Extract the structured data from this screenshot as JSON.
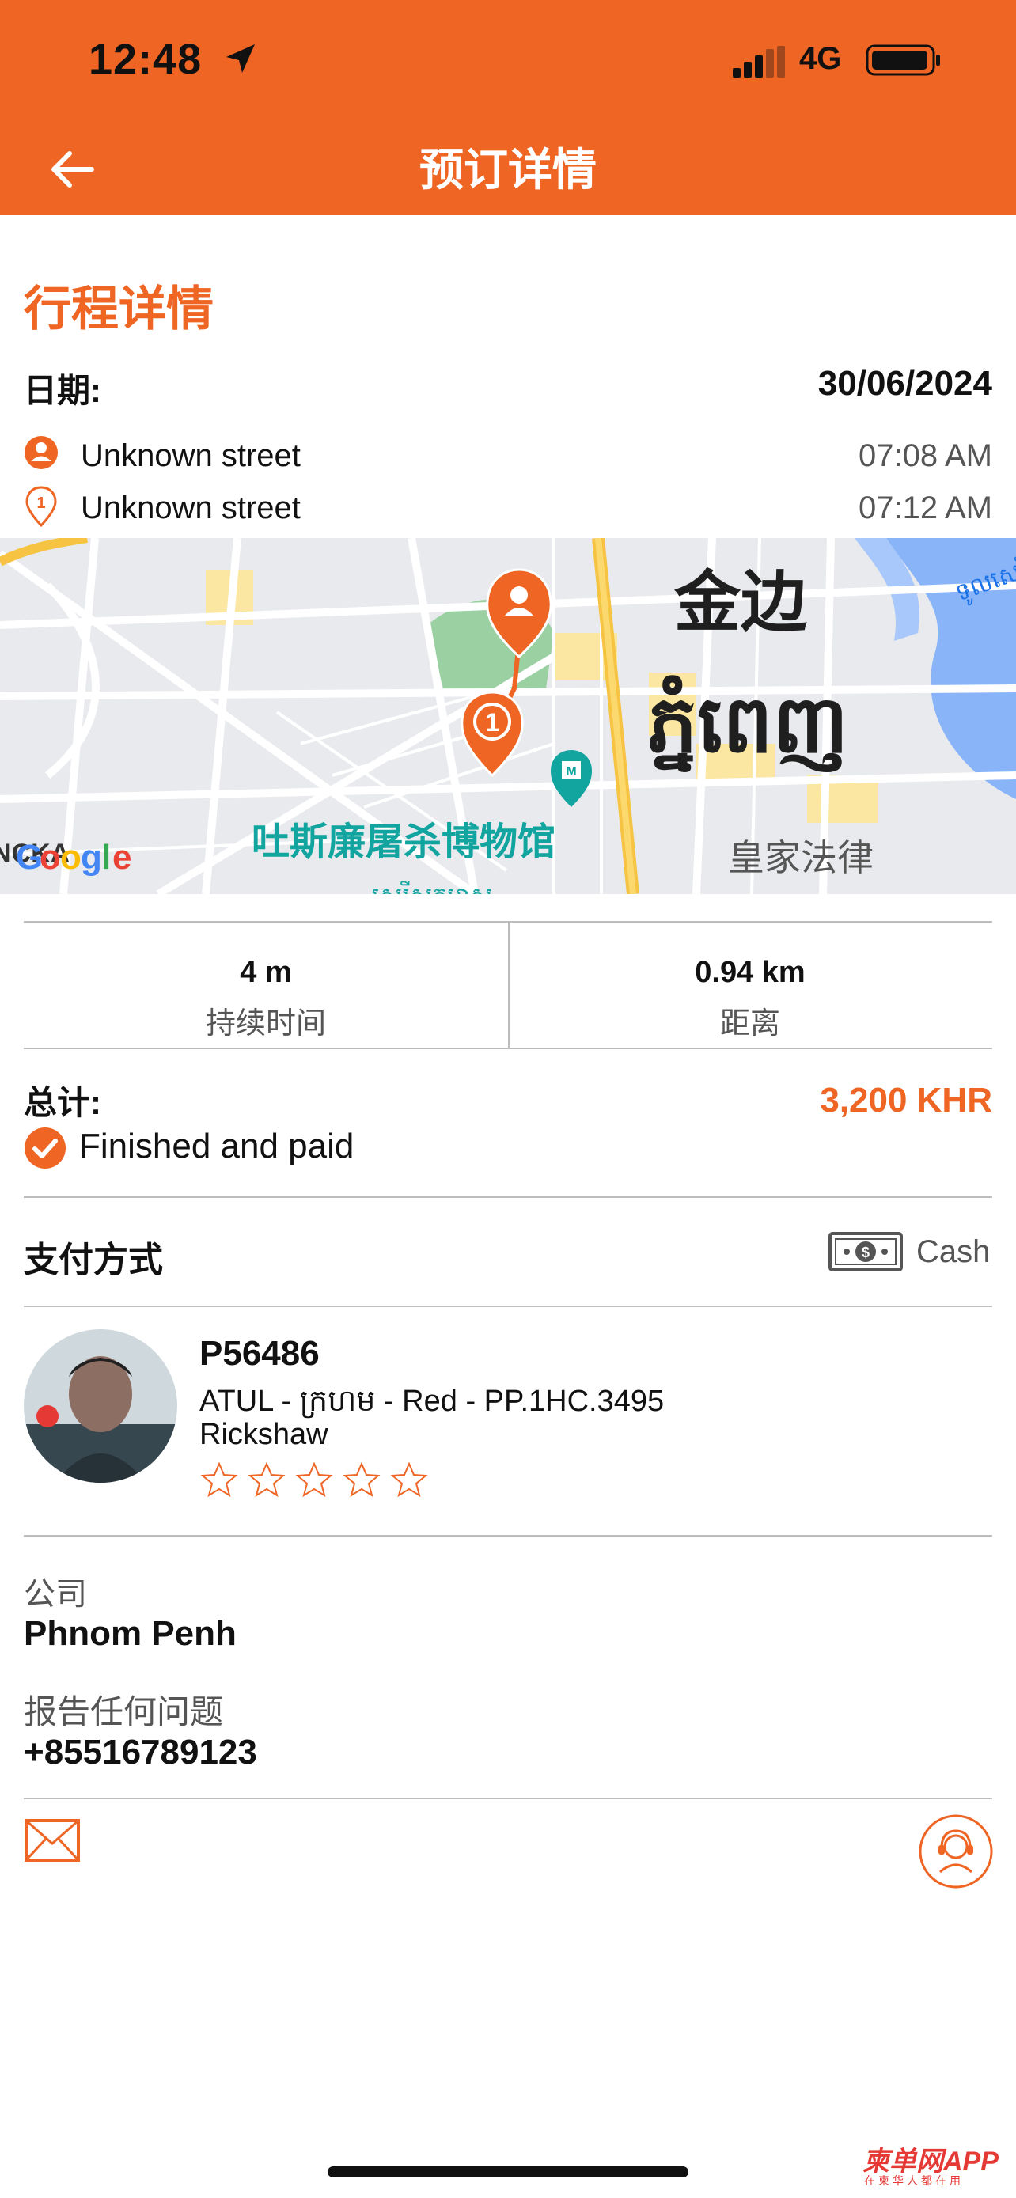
{
  "status_bar": {
    "time": "12:48",
    "network": "4G"
  },
  "header": {
    "title": "预订详情"
  },
  "trip": {
    "section_title": "行程详情",
    "date_label": "日期:",
    "date_value": "30/06/2024",
    "pickup": {
      "label": "Unknown street",
      "time": "07:08 AM"
    },
    "dropoff": {
      "label": "Unknown street",
      "time": "07:12 AM"
    }
  },
  "map": {
    "city_cn": "金边",
    "city_km": "ភ្នំពេញ",
    "museum": "吐斯廉屠杀博物馆",
    "royal": "皇家法律",
    "logo": "Google",
    "pin_number": "1",
    "partial_left": "NCKA",
    "partial_bottom": "សេរីសកម្មាស",
    "partial_right": "ទូលសេរី"
  },
  "stats": {
    "duration_value": "4 m",
    "duration_label": "持续时间",
    "distance_value": "0.94 km",
    "distance_label": "距离"
  },
  "total": {
    "label": "总计:",
    "value": "3,200 KHR",
    "status": "Finished and paid"
  },
  "payment": {
    "label": "支付方式",
    "method": "Cash"
  },
  "driver": {
    "plate": "P56486",
    "vehicle": "ATUL - ក្រហម - Red - PP.1HC.3495",
    "type": "Rickshaw",
    "rating": 0
  },
  "company": {
    "label": "公司",
    "value": "Phnom Penh"
  },
  "report": {
    "label": "报告任何问题",
    "value": "+85516789123"
  },
  "watermark": {
    "main": "柬单网APP",
    "sub": "在柬华人都在用"
  },
  "colors": {
    "accent": "#EE6524"
  }
}
